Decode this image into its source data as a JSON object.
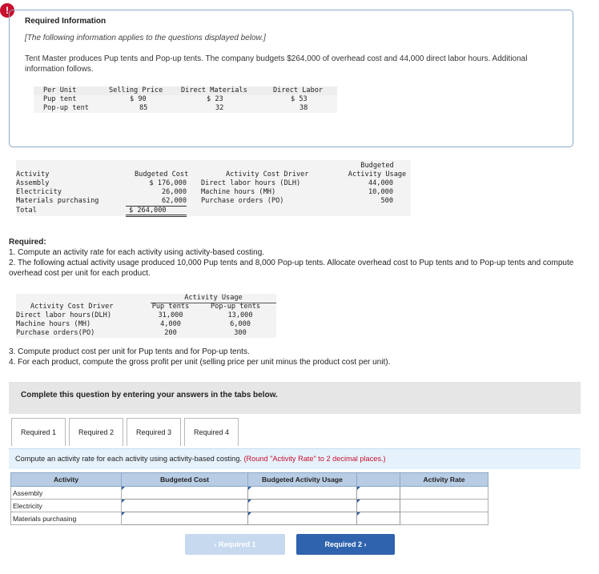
{
  "alert_glyph": "!",
  "info": {
    "title": "Required Information",
    "italic_note": "[The following information applies to the questions displayed below.]",
    "paragraph": "Tent Master produces Pup tents and Pop-up tents. The company budgets $264,000 of overhead cost and 44,000 direct labor hours. Additional information follows."
  },
  "unit_table": {
    "headers": [
      "Per Unit",
      "Selling Price",
      "Direct Materials",
      "Direct Labor"
    ],
    "rows": [
      [
        "Pup tent",
        "$ 90",
        "$ 23",
        "$ 53"
      ],
      [
        "Pop-up tent",
        "85",
        "32",
        "38"
      ]
    ]
  },
  "activity_table": {
    "headers": [
      "Activity",
      "Budgeted Cost",
      "Activity Cost Driver",
      "Budgeted",
      "Activity Usage"
    ],
    "rows": [
      [
        "Assembly",
        "$ 176,000",
        "Direct labor hours (DLH)",
        "44,000"
      ],
      [
        "Electricity",
        "26,000",
        "Machine hours (MH)",
        "10,000"
      ],
      [
        "Materials purchasing",
        "62,000",
        "Purchase orders (PO)",
        "500"
      ]
    ],
    "total_label": "Total",
    "total_value": "$ 264,000"
  },
  "required": {
    "heading": "Required:",
    "item1": "1. Compute an activity rate for each activity using activity-based costing.",
    "item2": "2. The following actual activity usage produced 10,000 Pup tents and 8,000 Pop-up tents. Allocate overhead cost to Pup tents and to Pop-up tents and compute overhead cost per unit for each product.",
    "item3": "3. Compute product cost per unit for Pup tents and for Pop-up tents.",
    "item4": "4. For each product, compute the gross profit per unit (selling price per unit minus the product cost per unit)."
  },
  "usage_table": {
    "group_header": "Activity Usage",
    "headers": [
      "Activity Cost Driver",
      "Pup tents",
      "Pop-up tents"
    ],
    "rows": [
      [
        "Direct labor hours(DLH)",
        "31,000",
        "13,000"
      ],
      [
        "Machine hours (MH)",
        "4,000",
        "6,000"
      ],
      [
        "Purchase orders(PO)",
        "200",
        "300"
      ]
    ]
  },
  "complete_text": "Complete this question by entering your answers in the tabs below.",
  "tabs": [
    "Required 1",
    "Required 2",
    "Required 3",
    "Required 4"
  ],
  "instruction": {
    "main": "Compute an activity rate for each activity using activity-based costing.",
    "note": "(Round \"Activity Rate\" to 2 decimal places.)"
  },
  "answer_table": {
    "headers": [
      "Activity",
      "Budgeted Cost",
      "Budgeted Activity Usage",
      "Activity Rate"
    ],
    "rows": [
      "Assembly",
      "Electricity",
      "Materials purchasing"
    ]
  },
  "nav": {
    "prev_label": "‹  Required 1",
    "next_label": "Required 2  ›"
  },
  "colors": {
    "header_blue": "#b8cce4",
    "next_button": "#2f63ae",
    "prev_button_disabled": "#c7d9ef",
    "alert_red": "#c8102e"
  }
}
